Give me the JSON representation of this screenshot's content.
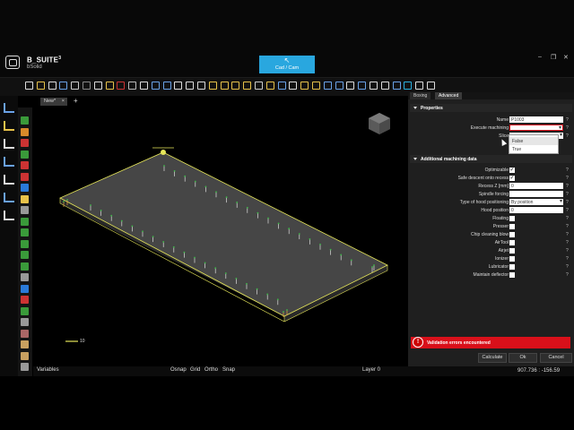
{
  "app": {
    "name": "B_SUITE",
    "name_sup": "3",
    "subtitle": "bSolid",
    "mode_button": "Cad / Cam"
  },
  "document_tabs": [
    {
      "label": "New*"
    }
  ],
  "add_tab_label": "+",
  "viewport": {
    "scale_label": "10",
    "part_color": "#464646",
    "outline_color": "#e6e65a"
  },
  "status_bar": {
    "variables": "Variables",
    "osnap": "Osnap",
    "grid": "Grid",
    "ortho": "Ortho",
    "snap": "Snap",
    "layer": "Layer 0",
    "coords": "907.736 : -156.59"
  },
  "panel": {
    "tabs": [
      "Boxing",
      "Advanced"
    ],
    "properties_title": "Properties",
    "properties": [
      {
        "label": "Name",
        "type": "text",
        "value": "P1003"
      },
      {
        "label": "Execute machining",
        "type": "dropdown",
        "value": ""
      },
      {
        "label": "Slice",
        "type": "dropdown",
        "value": ""
      }
    ],
    "slice_options": [
      "False",
      "True"
    ],
    "additional_title": "Additional machining data",
    "additional": [
      {
        "label": "Optimizable",
        "type": "check",
        "checked": true
      },
      {
        "label": "Safe descent onto recess",
        "type": "check",
        "checked": true
      },
      {
        "label": "Recess Z  [mm]",
        "type": "text",
        "value": "0"
      },
      {
        "label": "Spindle forcing",
        "type": "text",
        "value": ""
      },
      {
        "label": "Type of hood positioning",
        "type": "dropdown",
        "value": "By position"
      },
      {
        "label": "Hood position",
        "type": "text",
        "value": "0"
      },
      {
        "label": "Floating",
        "type": "check",
        "checked": false
      },
      {
        "label": "Presser",
        "type": "check",
        "checked": false
      },
      {
        "label": "Chip cleaning blow",
        "type": "check",
        "checked": false
      },
      {
        "label": "AirTool",
        "type": "check",
        "checked": false
      },
      {
        "label": "Airjet",
        "type": "check",
        "checked": false
      },
      {
        "label": "Ionizer",
        "type": "check",
        "checked": false
      },
      {
        "label": "Lubricator",
        "type": "check",
        "checked": false
      },
      {
        "label": "Maintain deflector",
        "type": "check",
        "checked": false
      }
    ],
    "help_glyph": "?",
    "error_text": "Validation errors encountered",
    "error_glyph": "!",
    "buttons": {
      "calculate": "Calculate",
      "ok": "Ok",
      "cancel": "Cancel"
    }
  },
  "colors": {
    "accent": "#29a7df",
    "error": "#d9101a"
  }
}
